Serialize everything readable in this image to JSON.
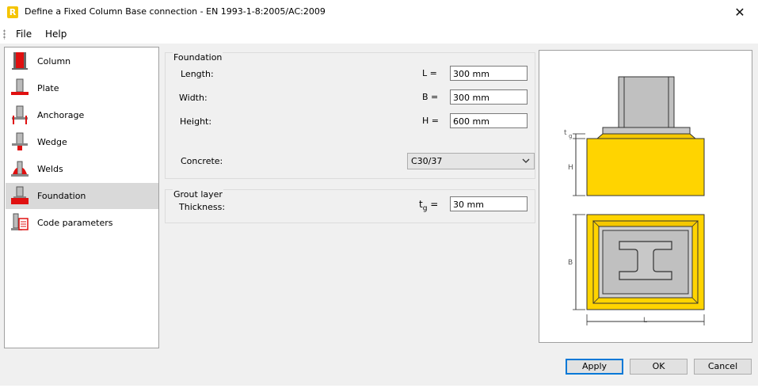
{
  "window": {
    "app_icon_letter": "R",
    "title": "Define a Fixed Column Base connection - EN 1993-1-8:2005/AC:2009",
    "close_glyph": "✕"
  },
  "menu": {
    "file": "File",
    "help": "Help"
  },
  "sidebar": {
    "items": [
      {
        "label": "Column",
        "icon": "column-icon"
      },
      {
        "label": "Plate",
        "icon": "plate-icon"
      },
      {
        "label": "Anchorage",
        "icon": "anchorage-icon"
      },
      {
        "label": "Wedge",
        "icon": "wedge-icon"
      },
      {
        "label": "Welds",
        "icon": "welds-icon"
      },
      {
        "label": "Foundation",
        "icon": "foundation-icon",
        "selected": true
      },
      {
        "label": "Code parameters",
        "icon": "code-parameters-icon"
      }
    ]
  },
  "foundation": {
    "group_title": "Foundation",
    "length": {
      "label": "Length:",
      "symbol": "L =",
      "value": "300 mm"
    },
    "width": {
      "label": "Width:",
      "symbol": "B =",
      "value": "300 mm"
    },
    "height": {
      "label": "Height:",
      "symbol": "H =",
      "value": "600 mm"
    },
    "concrete": {
      "label": "Concrete:",
      "value": "C30/37"
    }
  },
  "grout": {
    "group_title": "Grout layer",
    "thickness": {
      "label": "Thickness:",
      "symbol": "t",
      "subscript": "g",
      "equals": "=",
      "value": "30 mm"
    }
  },
  "diagram": {
    "tg_label": "t",
    "tg_sub": "g",
    "h_label": "H",
    "b_label": "B",
    "l_label": "L",
    "colors": {
      "concrete": "#ffd400",
      "steel": "#c0c0c0",
      "grout": "#a8a8a8"
    }
  },
  "buttons": {
    "apply": "Apply",
    "ok": "OK",
    "cancel": "Cancel"
  }
}
